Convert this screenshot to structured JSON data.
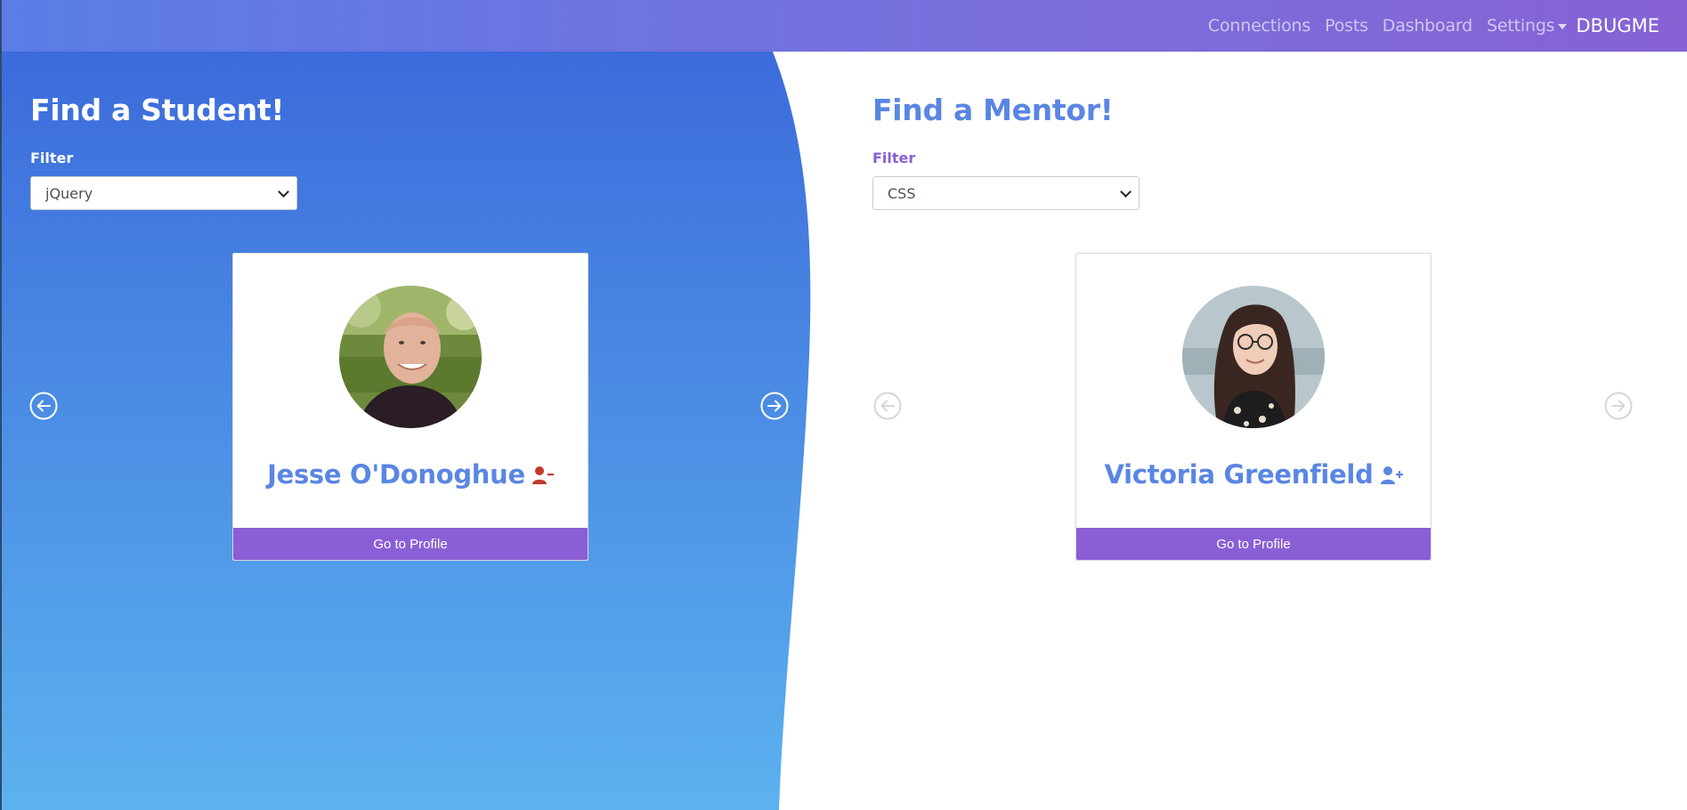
{
  "nav": {
    "links": [
      "Connections",
      "Posts",
      "Dashboard",
      "Settings"
    ],
    "brand": "DBUGME"
  },
  "students": {
    "title": "Find a Student!",
    "filter_label": "Filter",
    "filter_value": "jQuery",
    "card": {
      "name": "Jesse O'Donoghue",
      "connection_icon": "user-minus-icon",
      "button": "Go to Profile"
    }
  },
  "mentors": {
    "title": "Find a Mentor!",
    "filter_label": "Filter",
    "filter_value": "CSS",
    "card": {
      "name": "Victoria Greenfield",
      "connection_icon": "user-plus-icon",
      "button": "Go to Profile"
    }
  },
  "colors": {
    "nav_gradient_start": "#5a7de6",
    "nav_gradient_end": "#8662d4",
    "left_panel_top": "#3c6edb",
    "left_panel_bottom": "#5bb1ee",
    "accent_blue": "#5a86e3",
    "accent_purple": "#8a5fd6",
    "remove_red": "#c0392b"
  }
}
